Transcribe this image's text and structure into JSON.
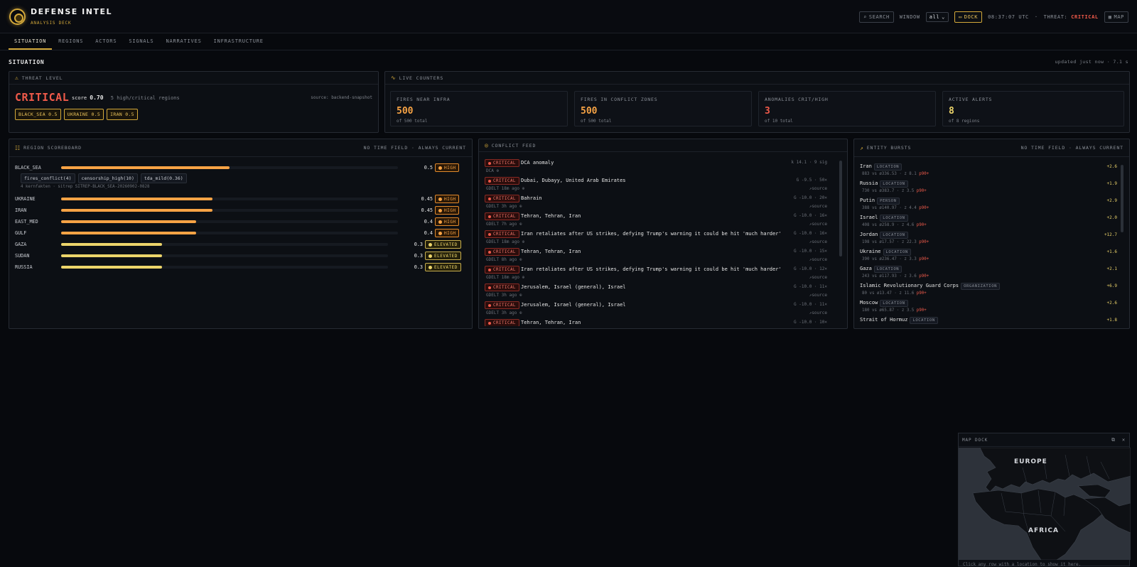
{
  "header": {
    "title": "DEFENSE INTEL",
    "subtitle": "ANALYSIS DECK",
    "search_label": "SEARCH",
    "window_label": "WINDOW",
    "window_value": "all",
    "dock_label": "DOCK",
    "clock": "08:37:07 UTC",
    "threat_label": "THREAT:",
    "threat_value": "CRITICAL",
    "map_label": "MAP"
  },
  "tabs": [
    "SITUATION",
    "REGIONS",
    "ACTORS",
    "SIGNALS",
    "NARRATIVES",
    "INFRASTRUCTURE"
  ],
  "section": {
    "title": "SITUATION",
    "updated": "updated just now · 7.1 s"
  },
  "threat": {
    "header": "THREAT LEVEL",
    "level": "CRITICAL",
    "score_label": "score",
    "score": "0.70",
    "summary": "5 high/critical regions",
    "source": "source: backend-snapshot",
    "chips": [
      "BLACK_SEA 0.5",
      "UKRAINE 0.5",
      "IRAN 0.5"
    ]
  },
  "counters": {
    "header": "LIVE COUNTERS",
    "items": [
      {
        "label": "FIRES NEAR INFRA",
        "value": "500",
        "sub": "of 500 total"
      },
      {
        "label": "FIRES IN CONFLICT ZONES",
        "value": "500",
        "sub": "of 500 total"
      },
      {
        "label": "ANOMALIES CRIT/HIGH",
        "value": "3",
        "sub": "of 10 total"
      },
      {
        "label": "ACTIVE ALERTS",
        "value": "8",
        "sub": "of 8 regions"
      }
    ]
  },
  "scoreboard": {
    "header": "REGION SCOREBOARD",
    "right": "NO TIME FIELD · ALWAYS CURRENT",
    "sub_chips": [
      "fires_conflict(4)",
      "censorship_high(10)",
      "tda_mild(0.36)"
    ],
    "sub_note": "4 kernfakten · sitrep SITREP-BLACK_SEA-20260902-0828",
    "rows": [
      {
        "name": "BLACK_SEA",
        "value": "0.5",
        "level": "HIGH",
        "score": 0.5
      },
      {
        "name": "UKRAINE",
        "value": "0.45",
        "level": "HIGH",
        "score": 0.45
      },
      {
        "name": "IRAN",
        "value": "0.45",
        "level": "HIGH",
        "score": 0.45
      },
      {
        "name": "EAST_MED",
        "value": "0.4",
        "level": "HIGH",
        "score": 0.4
      },
      {
        "name": "GULF",
        "value": "0.4",
        "level": "HIGH",
        "score": 0.4
      },
      {
        "name": "GAZA",
        "value": "0.3",
        "level": "ELEVATED",
        "score": 0.3
      },
      {
        "name": "SUDAN",
        "value": "0.3",
        "level": "ELEVATED",
        "score": 0.3
      },
      {
        "name": "RUSSIA",
        "value": "0.3",
        "level": "ELEVATED",
        "score": 0.3
      }
    ]
  },
  "feed": {
    "header": "CONFLICT FEED",
    "badge": "CRITICAL",
    "items": [
      {
        "title": "DCA anomaly",
        "meta": "DCA",
        "right": "k 14.1 · 9 sig",
        "src": ""
      },
      {
        "title": "Dubai, Dubayy, United Arab Emirates",
        "meta": "GDELT 18m ago",
        "right": "G -9.5 · 50×",
        "src": "source"
      },
      {
        "title": "Bahrain",
        "meta": "GDELT 3h ago",
        "right": "G -10.0 · 20×",
        "src": "source"
      },
      {
        "title": "Tehran, Tehran, Iran",
        "meta": "GDELT 7h ago",
        "right": "G -10.0 · 16×",
        "src": "source"
      },
      {
        "title": "Iran retaliates after US strikes, defying Trump's warning it could be hit 'much harder'",
        "meta": "GDELT 18m ago",
        "right": "G -10.0 · 16×",
        "src": "source"
      },
      {
        "title": "Tehran, Tehran, Iran",
        "meta": "GDELT 8h ago",
        "right": "G -10.0 · 15×",
        "src": "source"
      },
      {
        "title": "Iran retaliates after US strikes, defying Trump's warning it could be hit 'much harder'",
        "meta": "GDELT 18m ago",
        "right": "G -10.0 · 12×",
        "src": "source"
      },
      {
        "title": "Jerusalem, Israel (general), Israel",
        "meta": "GDELT 3h ago",
        "right": "G -10.0 · 11×",
        "src": "source"
      },
      {
        "title": "Jerusalem, Israel (general), Israel",
        "meta": "GDELT 3h ago",
        "right": "G -10.0 · 11×",
        "src": "source"
      },
      {
        "title": "Tehran, Tehran, Iran",
        "meta": "",
        "right": "G -10.0 · 10×",
        "src": ""
      }
    ]
  },
  "entities": {
    "header": "ENTITY BURSTS",
    "right": "NO TIME FIELD · ALWAYS CURRENT",
    "items": [
      {
        "name": "Iran",
        "type": "LOCATION",
        "meta": "883 vs ø336.53 · z 8.1",
        "p": "p90+",
        "delta": "+2.6"
      },
      {
        "name": "Russia",
        "type": "LOCATION",
        "meta": "730 vs ø383.7 · z 3.5",
        "p": "p90+",
        "delta": "+1.9"
      },
      {
        "name": "Putin",
        "type": "PERSON",
        "meta": "388 vs ø140.97 · z 4.4",
        "p": "p90+",
        "delta": "+2.9"
      },
      {
        "name": "Israel",
        "type": "LOCATION",
        "meta": "408 vs ø258.9 · z 4.6",
        "p": "p90+",
        "delta": "+2.0"
      },
      {
        "name": "Jordan",
        "type": "LOCATION",
        "meta": "198 vs ø17.57 · z 22.3",
        "p": "p90+",
        "delta": "+12.7"
      },
      {
        "name": "Ukraine",
        "type": "LOCATION",
        "meta": "390 vs ø236.47 · z 3.3",
        "p": "p90+",
        "delta": "+1.6"
      },
      {
        "name": "Gaza",
        "type": "LOCATION",
        "meta": "243 vs ø117.93 · z 3.6",
        "p": "p90+",
        "delta": "+2.1"
      },
      {
        "name": "Islamic Revolutionary Guard Corps",
        "type": "ORGANIZATION",
        "meta": "80 vs ø13.47 · z 11.6",
        "p": "p90+",
        "delta": "+6.9"
      },
      {
        "name": "Moscow",
        "type": "LOCATION",
        "meta": "180 vs ø65.87 · z 3.5",
        "p": "p90+",
        "delta": "+2.6"
      },
      {
        "name": "Strait of Hormuz",
        "type": "LOCATION",
        "meta": "",
        "p": "",
        "delta": "+1.8"
      }
    ]
  },
  "map_dock": {
    "header": "MAP DOCK",
    "label_europe": "EUROPE",
    "label_africa": "AFRICA",
    "hint": "Click any row with a location to show it here."
  },
  "colors": {
    "accent": "#d4a93a",
    "critical": "#f05a4a",
    "high": "#f7a345",
    "elevated": "#ecd46a"
  }
}
